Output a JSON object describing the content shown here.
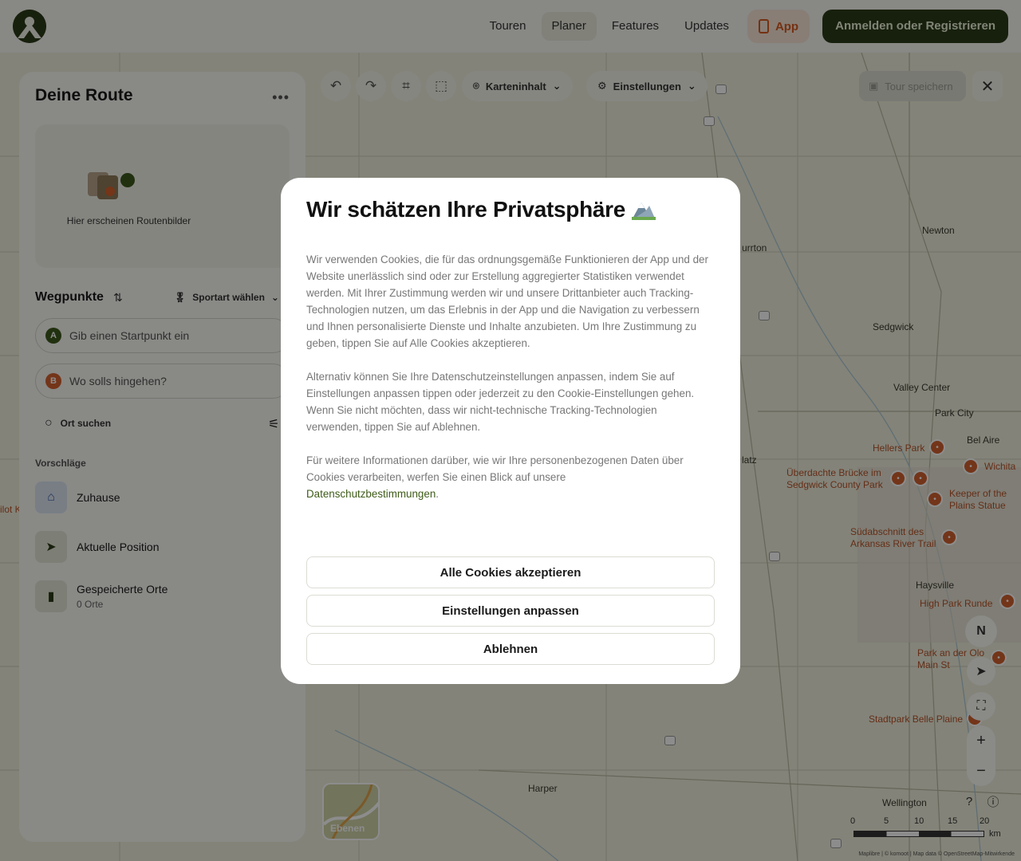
{
  "header": {
    "nav": [
      "Touren",
      "Planer",
      "Features",
      "Updates"
    ],
    "active_nav": "Planer",
    "app_label": "App",
    "login_label": "Anmelden oder Registrieren"
  },
  "toolbar": {
    "map_content_label": "Karteninhalt",
    "settings_label": "Einstellungen",
    "save_tour_label": "Tour speichern"
  },
  "sidebar": {
    "title": "Deine Route",
    "route_images_caption": "Hier erscheinen Routenbilder",
    "waypoints_heading": "Wegpunkte",
    "sport_label": "Sportart wählen",
    "start_placeholder": "Gib einen Startpunkt ein",
    "start_badge": "A",
    "end_placeholder": "Wo solls hingehen?",
    "end_badge": "B",
    "search_label": "Ort suchen",
    "suggestions_label": "Vorschläge",
    "suggestions": [
      {
        "label": "Zuhause",
        "sub": ""
      },
      {
        "label": "Aktuelle Position",
        "sub": ""
      },
      {
        "label": "Gespeicherte Orte",
        "sub": "0 Orte"
      }
    ]
  },
  "map": {
    "labels": {
      "newton": "Newton",
      "burrton": "urrton",
      "sedgwick": "Sedgwick",
      "valley_center": "Valley Center",
      "park_city": "Park City",
      "bel_aire": "Bel Aire",
      "hellers_park": "Hellers Park",
      "wichita": "Wichita",
      "haysville": "Haysville",
      "harper": "Harper",
      "wellington": "Wellington",
      "platz": "latz",
      "left_edge": "ilot K"
    },
    "pois": {
      "bridge": "Überdachte Brücke im\nSedgwick County Park",
      "keeper": "Keeper of the\nPlains Statue",
      "river_trail": "Südabschnitt des\nArkansas River Trail",
      "high_park": "High Park Runde",
      "olo": "Park an der Olo\nMain St",
      "belle_plaine": "Stadtpark Belle Plaine"
    },
    "layers_label": "Ebenen",
    "compass_label": "N",
    "scale": {
      "ticks": [
        "0",
        "5",
        "10",
        "15",
        "20"
      ],
      "unit": "km"
    },
    "attribution": "Maplibre | © komoot | Map data © OpenStreetMap-Mitwirkende"
  },
  "cookie_modal": {
    "title": "Wir schätzen Ihre Privatsphäre",
    "paragraph1": "Wir verwenden Cookies, die für das ordnungsgemäße Funktionieren der App und der Website unerlässlich sind oder zur Erstellung aggregierter Statistiken verwendet werden. Mit Ihrer Zustimmung werden wir und unsere Drittanbieter auch Tracking-Technologien nutzen, um das Erlebnis in der App und die Navigation zu verbessern und Ihnen personalisierte Dienste und Inhalte anzubieten. Um Ihre Zustimmung zu geben, tippen Sie auf Alle Cookies akzeptieren.",
    "paragraph2": "Alternativ können Sie Ihre Datenschutzeinstellungen anpassen, indem Sie auf Einstellungen anpassen tippen oder jederzeit zu den Cookie-Einstellungen gehen. Wenn Sie nicht möchten, dass wir nicht-technische Tracking-Technologien verwenden, tippen Sie auf Ablehnen.",
    "paragraph3": "Für weitere Informationen darüber, wie wir Ihre personenbezogenen Daten über Cookies verarbeiten, werfen Sie einen Blick auf unsere",
    "privacy_link": "Datenschutzbestimmungen",
    "accept_label": "Alle Cookies akzeptieren",
    "customize_label": "Einstellungen anpassen",
    "decline_label": "Ablehnen"
  },
  "colors": {
    "brand_dark_green": "#2b3b17",
    "accent_orange": "#d65a1f",
    "link_green": "#3e5b17"
  }
}
